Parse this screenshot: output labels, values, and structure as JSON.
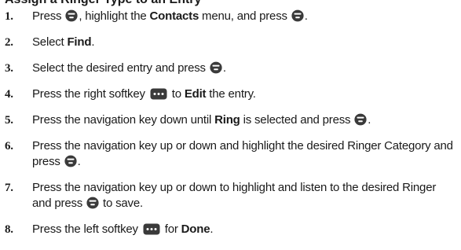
{
  "heading": "Assign a Ringer Type to an Entry",
  "icons": {
    "menu_ok": "menu-ok-key-icon",
    "softkey": "softkey-icon"
  },
  "steps": [
    {
      "number": "1.",
      "parts": [
        {
          "t": "Press "
        },
        {
          "icon": "menu_ok"
        },
        {
          "t": ", highlight the "
        },
        {
          "t": "Contacts",
          "b": true
        },
        {
          "t": " menu, and press "
        },
        {
          "icon": "menu_ok"
        },
        {
          "t": "."
        }
      ]
    },
    {
      "number": "2.",
      "parts": [
        {
          "t": "Select "
        },
        {
          "t": "Find",
          "b": true
        },
        {
          "t": "."
        }
      ]
    },
    {
      "number": "3.",
      "parts": [
        {
          "t": "Select the desired entry and press "
        },
        {
          "icon": "menu_ok"
        },
        {
          "t": "."
        }
      ]
    },
    {
      "number": "4.",
      "parts": [
        {
          "t": "Press the right softkey "
        },
        {
          "icon": "softkey"
        },
        {
          "t": " to "
        },
        {
          "t": "Edit",
          "b": true
        },
        {
          "t": " the entry."
        }
      ]
    },
    {
      "number": "5.",
      "parts": [
        {
          "t": "Press the navigation key down until "
        },
        {
          "t": "Ring",
          "b": true
        },
        {
          "t": " is selected and press "
        },
        {
          "icon": "menu_ok"
        },
        {
          "t": "."
        }
      ]
    },
    {
      "number": "6.",
      "parts": [
        {
          "t": "Press the navigation key up or down and highlight the desired Ringer Category and press "
        },
        {
          "icon": "menu_ok"
        },
        {
          "t": "."
        }
      ]
    },
    {
      "number": "7.",
      "parts": [
        {
          "t": "Press the navigation key up or down to highlight and listen to the desired Ringer and press "
        },
        {
          "icon": "menu_ok"
        },
        {
          "t": " to save."
        }
      ]
    },
    {
      "number": "8.",
      "parts": [
        {
          "t": "Press the left softkey "
        },
        {
          "icon": "softkey"
        },
        {
          "t": " for "
        },
        {
          "t": "Done",
          "b": true
        },
        {
          "t": "."
        }
      ]
    }
  ]
}
